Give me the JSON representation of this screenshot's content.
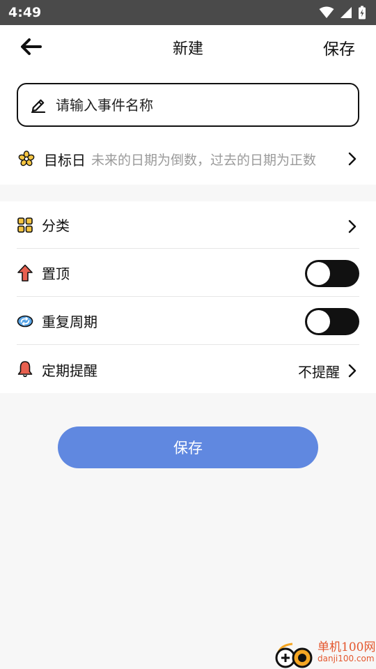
{
  "status_bar": {
    "time": "4:49"
  },
  "nav": {
    "title": "新建",
    "save_label": "保存"
  },
  "name_input": {
    "placeholder": "请输入事件名称",
    "value": ""
  },
  "target_date": {
    "label": "目标日",
    "hint": "未来的日期为倒数，过去的日期为正数"
  },
  "settings": {
    "category": {
      "label": "分类"
    },
    "pin_top": {
      "label": "置顶",
      "enabled": false
    },
    "repeat": {
      "label": "重复周期",
      "enabled": false
    },
    "reminder": {
      "label": "定期提醒",
      "value": "不提醒"
    }
  },
  "save_button": {
    "label": "保存"
  },
  "watermark": {
    "name": "单机100网",
    "url": "danji100.com"
  },
  "colors": {
    "accent": "#6088e0",
    "toggle_track": "#111111",
    "hint": "#9a9a9a",
    "watermark": "#e4572e"
  }
}
